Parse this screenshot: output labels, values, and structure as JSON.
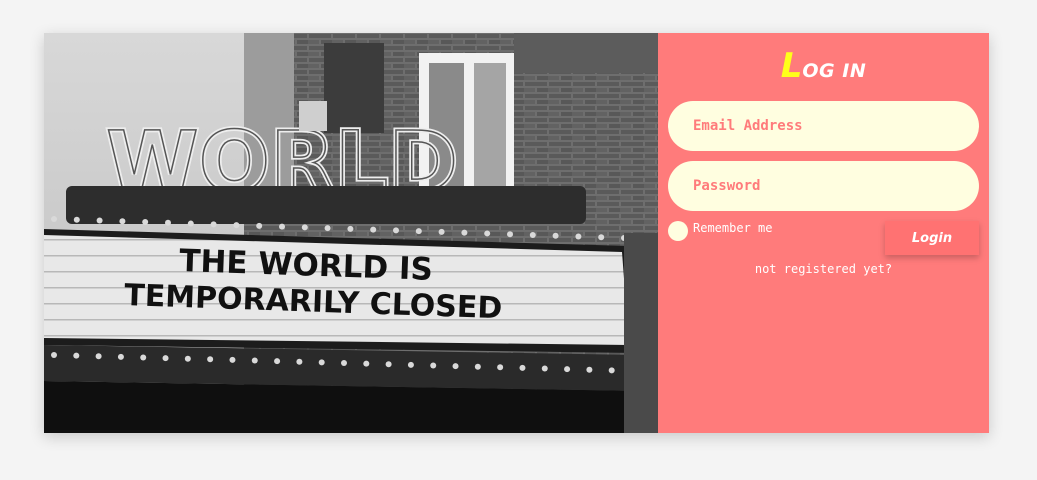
{
  "photo": {
    "sign_word": "WORLD",
    "marquee_line_1": "THE WORLD IS",
    "marquee_line_2": "TEMPORARILY CLOSED"
  },
  "login": {
    "title_first_letter": "L",
    "title_rest": "OG IN",
    "email_placeholder": "Email Address",
    "password_placeholder": "Password",
    "remember_label": "Remember me",
    "login_button": "Login",
    "register_link": "not registered yet?"
  },
  "colors": {
    "panel_background": "#ff7b7b",
    "input_background": "#fffee0",
    "title_accent": "#ffff1a",
    "page_background": "#f4f4f4"
  }
}
